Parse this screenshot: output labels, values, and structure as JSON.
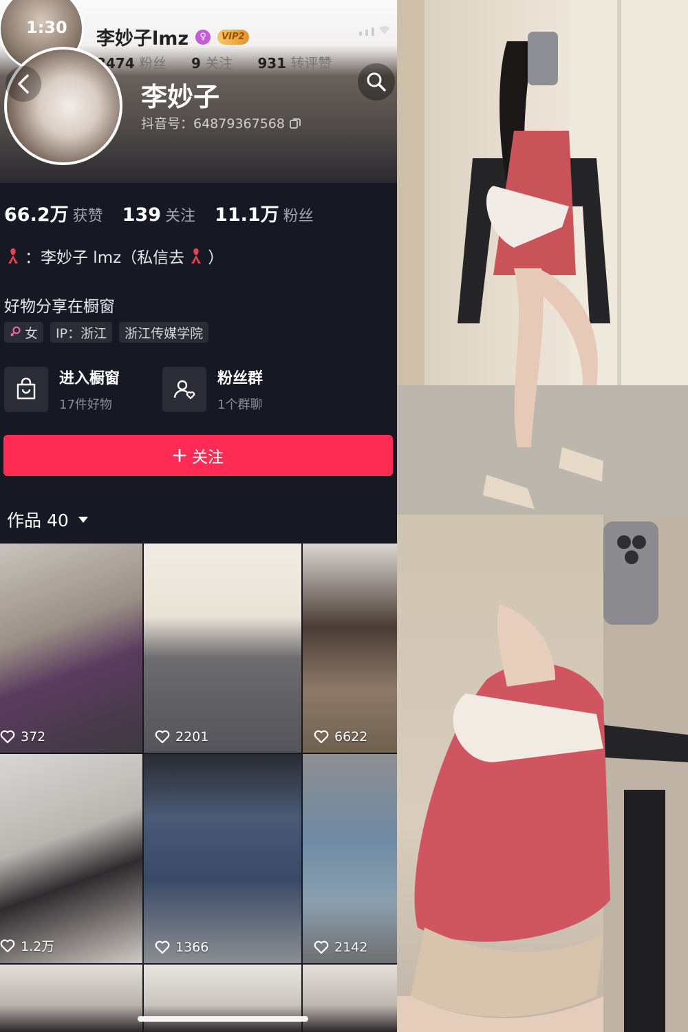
{
  "status": {
    "time": "1:30"
  },
  "overlay": {
    "name": "李妙子lmz",
    "vip": "VIP2",
    "stats": [
      {
        "value": "2474",
        "label": "粉丝"
      },
      {
        "value": "9",
        "label": "关注"
      },
      {
        "value": "931",
        "label": "转评赞"
      }
    ]
  },
  "profile": {
    "name": "李妙子",
    "douyin_id": "抖音号：64879367568",
    "stats": [
      {
        "value": "66.2万",
        "label": "获赞"
      },
      {
        "value": "139",
        "label": "关注"
      },
      {
        "value": "11.1万",
        "label": "粉丝"
      }
    ],
    "bio_line1": "：李妙子 lmz（私信去",
    "bio_line1_end": "）",
    "bio_line2": "好物分享在橱窗",
    "tags": [
      "女",
      "IP：浙江",
      "浙江传媒学院"
    ]
  },
  "shortcuts": [
    {
      "title": "进入橱窗",
      "subtitle": "17件好物",
      "icon": "shopping-bag-icon"
    },
    {
      "title": "粉丝群",
      "subtitle": "1个群聊",
      "icon": "fan-group-icon"
    }
  ],
  "follow_label": "关注",
  "works_label": "作品 40",
  "videos": [
    {
      "likes": "372"
    },
    {
      "likes": "2201"
    },
    {
      "likes": "6622"
    },
    {
      "likes": "1.2万"
    },
    {
      "likes": "1366"
    },
    {
      "likes": "2142"
    }
  ],
  "colors": {
    "accent": "#fe2c55",
    "background": "#161823"
  }
}
